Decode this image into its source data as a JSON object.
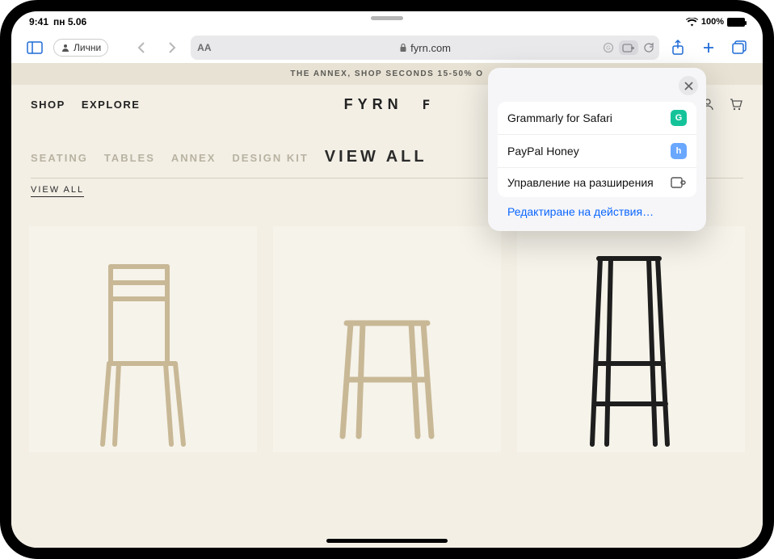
{
  "status": {
    "time": "9:41",
    "date": "пн 5.06",
    "battery_pct": "100%"
  },
  "toolbar": {
    "profile_label": "Лични",
    "aa": "AA",
    "url_host": "fyrn.com"
  },
  "site": {
    "banner": "THE ANNEX, SHOP SECONDS 15-50% O",
    "nav": {
      "shop": "SHOP",
      "explore": "EXPLORE"
    },
    "brand": "FYRN",
    "brand_mono": "F",
    "filters": {
      "seating": "SEATING",
      "tables": "TABLES",
      "annex": "ANNEX",
      "design_kit": "DESIGN KIT",
      "view_all": "VIEW ALL"
    },
    "view_all_small": "VIEW ALL"
  },
  "popover": {
    "items": [
      {
        "label": "Grammarly for Safari",
        "icon": "G",
        "color": "green"
      },
      {
        "label": "PayPal Honey",
        "icon": "h",
        "color": "blue"
      }
    ],
    "manage": "Управление на разширения",
    "edit": "Редактиране на действия…"
  }
}
